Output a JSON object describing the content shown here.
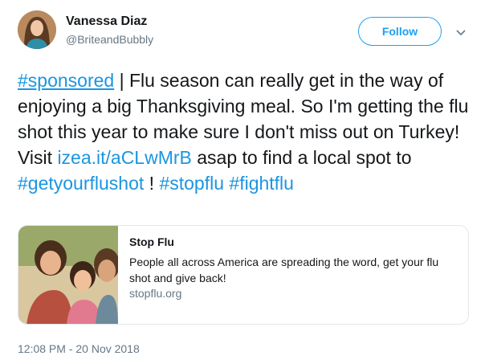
{
  "user": {
    "name": "Vanessa Diaz",
    "handle": "@BriteandBubbly",
    "avatar_icon": "user-avatar"
  },
  "follow_label": "Follow",
  "tweet": {
    "hashtag_sponsored": "#sponsored",
    "text_1": " | Flu season can really get in the way of enjoying a big Thanksgiving meal. So I'm getting the flu shot this year to make sure I don't miss out on Turkey! Visit ",
    "url": "izea.it/aCLwMrB",
    "text_2": " asap to find a local spot to ",
    "hashtag_getyourflushot": "#getyourflushot",
    "text_3": " ! ",
    "hashtag_stopflu": "#stopflu",
    "text_4": " ",
    "hashtag_fightflu": "#fightflu"
  },
  "card": {
    "title": "Stop Flu",
    "description": "People all across America are spreading the word, get your flu shot and give back!",
    "domain": "stopflu.org"
  },
  "timestamp": "12:08 PM - 20 Nov 2018",
  "colors": {
    "link": "#1b95e0",
    "follow": "#1da1f2",
    "secondary_text": "#657786"
  }
}
